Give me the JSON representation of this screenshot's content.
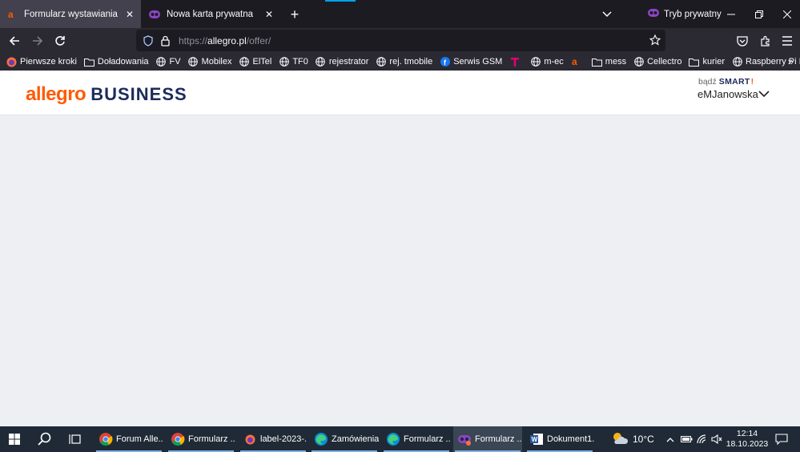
{
  "browser": {
    "tabs": [
      {
        "label": "Formularz wystawiania",
        "icon": "allegro-icon",
        "active": true
      },
      {
        "label": "Nowa karta prywatna",
        "icon": "private-mask-icon",
        "active": false
      }
    ],
    "private_label": "Tryb prywatny",
    "url": {
      "scheme": "https://",
      "host": "allegro.pl",
      "path": "/offer/"
    },
    "bookmarks": [
      {
        "label": "Pierwsze kroki",
        "icon": "firefox-icon"
      },
      {
        "label": "Doładowania",
        "icon": "folder-icon"
      },
      {
        "label": "FV",
        "icon": "globe-icon"
      },
      {
        "label": "Mobilex",
        "icon": "globe-icon"
      },
      {
        "label": "ElTel",
        "icon": "globe-icon"
      },
      {
        "label": "TF0",
        "icon": "globe-icon"
      },
      {
        "label": "rejestrator",
        "icon": "globe-icon"
      },
      {
        "label": "rej. tmobile",
        "icon": "globe-icon"
      },
      {
        "label": "Serwis GSM",
        "icon": "facebook-icon"
      },
      {
        "label": "",
        "icon": "tmobile-icon"
      },
      {
        "label": "m-ec",
        "icon": "globe-icon"
      },
      {
        "label": "",
        "icon": "allegro-icon"
      },
      {
        "label": "mess",
        "icon": "folder-icon"
      },
      {
        "label": "Cellectro",
        "icon": "globe-icon"
      },
      {
        "label": "kurier",
        "icon": "folder-icon"
      },
      {
        "label": "Raspberry Pi Image D...",
        "icon": "globe-icon"
      }
    ]
  },
  "page": {
    "logo": {
      "part1": "allegro",
      "part2": "BUSINESS"
    },
    "smart_prefix": "bądź",
    "smart_word": "SMART",
    "smart_mark": "!",
    "username": "eMJanowska"
  },
  "taskbar": {
    "apps": [
      {
        "label": "Forum Alle...",
        "icon": "chrome-icon",
        "active": false
      },
      {
        "label": "Formularz ...",
        "icon": "chrome-icon",
        "active": false
      },
      {
        "label": "label-2023-...",
        "icon": "firefox-icon",
        "active": false
      },
      {
        "label": "Zamówienia...",
        "icon": "edge-icon",
        "active": false
      },
      {
        "label": "Formularz ...",
        "icon": "edge-icon",
        "active": false
      },
      {
        "label": "Formularz ...",
        "icon": "firefox-private-icon",
        "active": true
      },
      {
        "label": "Dokument1...",
        "icon": "word-icon",
        "active": false
      }
    ],
    "weather": "10°C",
    "time": "12:14",
    "date": "18.10.2023"
  },
  "colors": {
    "allegro_orange": "#ff5a00",
    "business_navy": "#1c2b5a",
    "browser_dark": "#1c1b22",
    "taskbar": "#1f2a36",
    "page_bg": "#edeff2"
  }
}
